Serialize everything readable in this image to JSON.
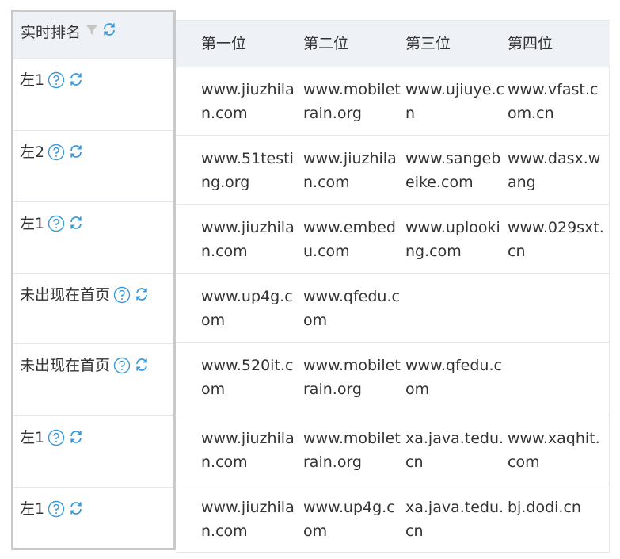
{
  "header": {
    "rank_title": "实时排名",
    "columns": [
      "第一位",
      "第二位",
      "第三位",
      "第四位"
    ]
  },
  "colors": {
    "accent": "#3a9ad9",
    "header_bg": "#eef1f6",
    "border": "#e3e6eb",
    "frozen_border": "#c9c9c9"
  },
  "icons": {
    "filter": "filter-icon",
    "help": "question-circle-icon",
    "refresh": "refresh-icon"
  },
  "rows": [
    {
      "rank": "左1",
      "sites": [
        "www.jiuzhilan.com",
        "www.mobiletrain.org",
        "www.ujiuye.cn",
        "www.vfast.com.cn"
      ]
    },
    {
      "rank": "左2",
      "sites": [
        "www.51testing.org",
        "www.jiuzhilan.com",
        "www.sangebeike.com",
        "www.dasx.wang"
      ]
    },
    {
      "rank": "左1",
      "sites": [
        "www.jiuzhilan.com",
        "www.embedu.com",
        "www.uplooking.com",
        "www.029sxt.cn"
      ]
    },
    {
      "rank": "未出现在首页",
      "sites": [
        "www.up4g.com",
        "www.qfedu.com",
        "",
        ""
      ]
    },
    {
      "rank": "未出现在首页",
      "sites": [
        "www.520it.com",
        "www.mobiletrain.org",
        "www.qfedu.com",
        ""
      ]
    },
    {
      "rank": "左1",
      "sites": [
        "www.jiuzhilan.com",
        "www.mobiletrain.org",
        "xa.java.tedu.cn",
        "www.xaqhit.com"
      ]
    },
    {
      "rank": "左1",
      "sites": [
        "www.jiuzhilan.com",
        "www.up4g.com",
        "xa.java.tedu.cn",
        "bj.dodi.cn"
      ]
    }
  ]
}
